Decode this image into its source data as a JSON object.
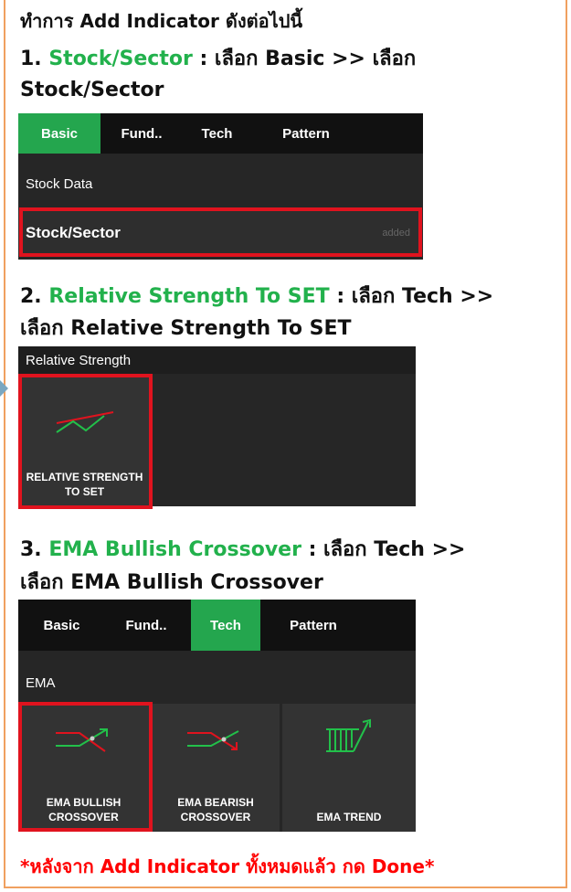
{
  "intro": {
    "prefix": "ทำการ ",
    "bold": "Add Indicator",
    "suffix": " ดังต่อไปนี้"
  },
  "step1": {
    "number": "1. ",
    "name": "Stock/Sector",
    "instruction": " : เลือก Basic >> เลือก",
    "line2": "Stock/Sector",
    "tabs": [
      "Basic",
      "Fund..",
      "Tech",
      "Pattern"
    ],
    "active_tab": "Basic",
    "section": "Stock Data",
    "row_label": "Stock/Sector",
    "row_status": "added"
  },
  "step2": {
    "number": "2. ",
    "name": "Relative Strength To SET",
    "instruction": " : เลือก Tech >>",
    "line2": "เลือก Relative Strength To SET",
    "section": "Relative Strength",
    "tile_label_1": "RELATIVE STRENGTH",
    "tile_label_2": "TO SET",
    "tile_icon": "relative-strength-icon"
  },
  "step3": {
    "number": "3. ",
    "name": "EMA Bullish Crossover",
    "instruction": " : เลือก Tech >>",
    "line2": "เลือก EMA Bullish Crossover",
    "tabs": [
      "Basic",
      "Fund..",
      "Tech",
      "Pattern"
    ],
    "active_tab": "Tech",
    "section": "EMA",
    "tiles": [
      {
        "line1": "EMA BULLISH",
        "line2": "CROSSOVER",
        "icon": "ema-bullish-icon"
      },
      {
        "line1": "EMA BEARISH",
        "line2": "CROSSOVER",
        "icon": "ema-bearish-icon"
      },
      {
        "line1": "",
        "line2": "EMA TREND",
        "icon": "ema-trend-icon"
      }
    ]
  },
  "footer": {
    "prefix": "*หลังจาก ",
    "bold": "Add Indicator",
    "middle": " ทั้งหมดแล้ว กด ",
    "done": "Done",
    "suffix": "*"
  },
  "colors": {
    "accent_green": "#24a64e",
    "highlight_red": "#e0131e",
    "border_orange": "#f0a060"
  }
}
